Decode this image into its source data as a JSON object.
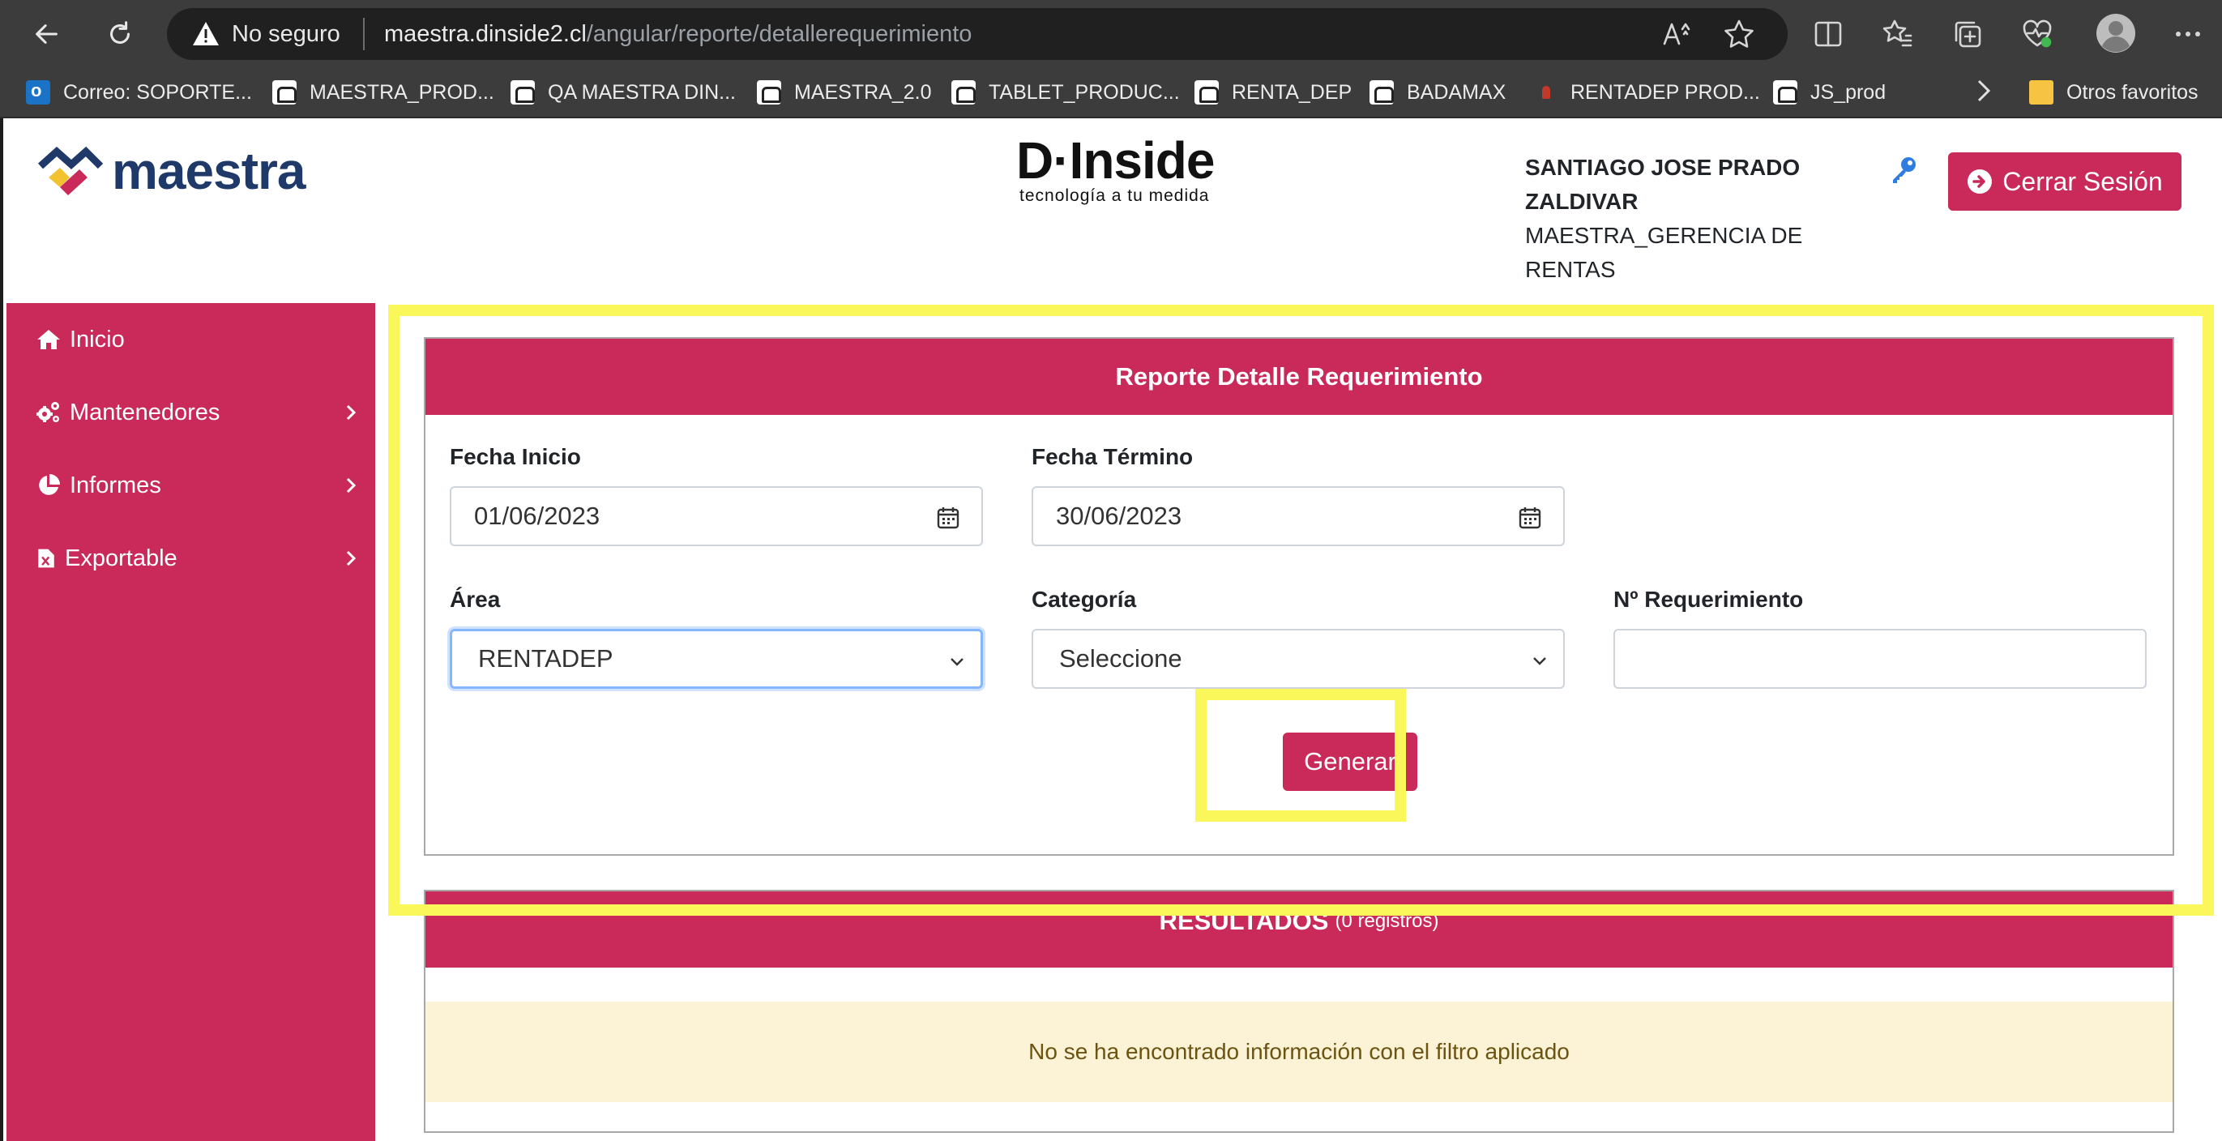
{
  "browser": {
    "security_label": "No seguro",
    "url_host": "maestra.dinside2.cl",
    "url_path": "/angular/reporte/detallerequerimiento",
    "bookmarks": [
      {
        "label": "Correo: SOPORTE...",
        "icon": "outlook-icon"
      },
      {
        "label": "MAESTRA_PROD...",
        "icon": "robot-icon"
      },
      {
        "label": "QA MAESTRA DIN...",
        "icon": "robot-icon"
      },
      {
        "label": "MAESTRA_2.0",
        "icon": "robot-icon"
      },
      {
        "label": "TABLET_PRODUC...",
        "icon": "robot-icon"
      },
      {
        "label": "RENTA_DEP",
        "icon": "robot-icon"
      },
      {
        "label": "BADAMAX",
        "icon": "robot-icon"
      },
      {
        "label": "RENTADEP PROD...",
        "icon": "dep-icon"
      },
      {
        "label": "JS_prod",
        "icon": "robot-icon"
      }
    ],
    "other_favorites": "Otros favoritos"
  },
  "header": {
    "logo_text": "maestra",
    "partner_logo_text": "D·Inside",
    "partner_tagline": "tecnología a tu medida",
    "user_name_line1": "SANTIAGO JOSE PRADO",
    "user_name_line2": "ZALDIVAR",
    "user_role_line1": "MAESTRA_GERENCIA DE",
    "user_role_line2": "RENTAS",
    "logout_label": "Cerrar Sesión"
  },
  "sidebar": {
    "items": [
      {
        "label": "Inicio",
        "icon": "home-icon",
        "has_submenu": false
      },
      {
        "label": "Mantenedores",
        "icon": "gears-icon",
        "has_submenu": true
      },
      {
        "label": "Informes",
        "icon": "pie-chart-icon",
        "has_submenu": true
      },
      {
        "label": "Exportable",
        "icon": "excel-file-icon",
        "has_submenu": true
      }
    ]
  },
  "report": {
    "title": "Reporte Detalle Requerimiento",
    "fecha_inicio_label": "Fecha Inicio",
    "fecha_inicio_value": "01/06/2023",
    "fecha_termino_label": "Fecha Término",
    "fecha_termino_value": "30/06/2023",
    "area_label": "Área",
    "area_value": "RENTADEP",
    "categoria_label": "Categoría",
    "categoria_value": "Seleccione",
    "requerimiento_label": "Nº Requerimiento",
    "requerimiento_value": "",
    "generate_label": "Generar"
  },
  "results": {
    "title": "RESULTADOS",
    "count_text": "(0 registros)",
    "empty_message": "No se ha encontrado información con el filtro aplicado"
  },
  "colors": {
    "brand": "#c92a5a",
    "highlight": "#f9f75a",
    "alert_bg": "#fcf3d6"
  }
}
